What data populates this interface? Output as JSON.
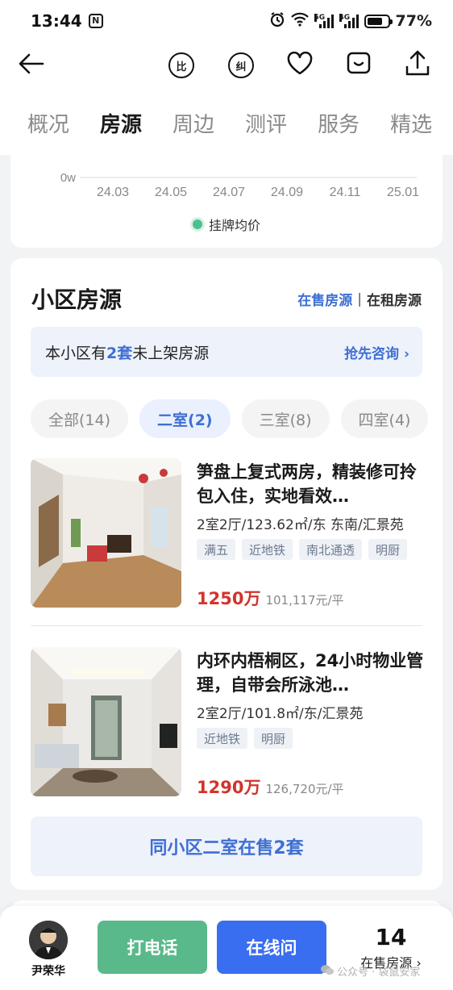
{
  "status_bar": {
    "time": "13:44",
    "nfc": "N",
    "net1": "5G",
    "net2": "4G",
    "battery_pct": "77%",
    "battery_level": 0.77
  },
  "nav": {
    "compare": "比",
    "correct": "纠"
  },
  "tabs": [
    "概况",
    "房源",
    "周边",
    "测评",
    "服务",
    "精选"
  ],
  "chart_data": {
    "type": "line",
    "x_ticks": [
      "24.03",
      "24.05",
      "24.07",
      "24.09",
      "24.11",
      "25.01"
    ],
    "y_ticks": [
      "0w"
    ],
    "series": [
      {
        "name": "挂牌均价",
        "values": []
      }
    ],
    "legend": "bottom-center",
    "colors": {
      "series": "#4fc08d"
    }
  },
  "listings_card": {
    "title": "小区房源",
    "sale_link": "在售房源",
    "separator": "|",
    "rent_link": "在租房源",
    "notice": {
      "prefix": "本小区有",
      "count": "2套",
      "suffix": "未上架房源",
      "cta": "抢先咨询 ›"
    },
    "filters": [
      {
        "label": "全部(14)",
        "active": false
      },
      {
        "label": "二室(2)",
        "active": true
      },
      {
        "label": "三室(8)",
        "active": false
      },
      {
        "label": "四室(4)",
        "active": false
      }
    ],
    "items": [
      {
        "title": "笋盘上复式两房，精装修可拎包入住，实地看效…",
        "spec": "2室2厅/123.62㎡/东 东南/汇景苑",
        "tags": [
          "满五",
          "近地铁",
          "南北通透",
          "明厨"
        ],
        "price": "1250万",
        "unit_price": "101,117元/平"
      },
      {
        "title": "内环内梧桐区，24小时物业管理，自带会所泳池…",
        "spec": "2室2厅/101.8㎡/东/汇景苑",
        "tags": [
          "近地铁",
          "明厨"
        ],
        "price": "1290万",
        "unit_price": "126,720元/平"
      }
    ],
    "more_button": "同小区二室在售2套"
  },
  "bottom_bar": {
    "agent_name": "尹荣华",
    "call": "打电话",
    "chat": "在线问",
    "onsale_count": "14",
    "onsale_label": "在售房源 ›"
  },
  "watermark": "公众号 · 袋鼠安家",
  "colors": {
    "accent": "#3e6fd3",
    "price": "#d2342b",
    "call": "#5ab98a",
    "chat": "#3a6ef0"
  }
}
